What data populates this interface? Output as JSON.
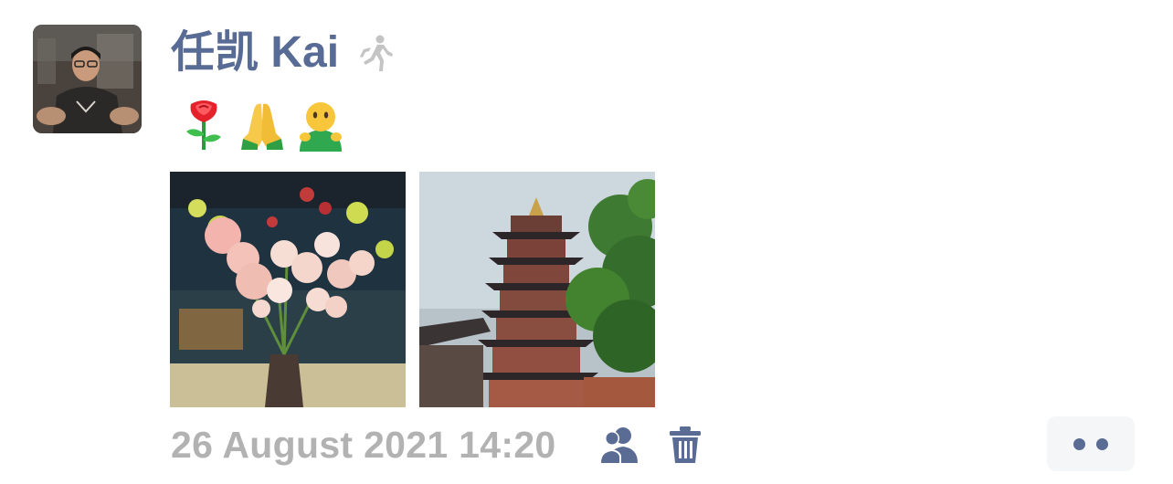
{
  "post": {
    "author": {
      "name": "任凯 Kai"
    },
    "content": {
      "emojis": [
        "🌹",
        "🙏",
        "🙂"
      ]
    },
    "timestamp": "26 August 2021 14:20"
  },
  "colors": {
    "name_link": "#586b95",
    "timestamp": "#b2b2b2",
    "icon_accent": "#5a6c94",
    "more_button_bg": "#f5f6f8"
  },
  "icons": {
    "status": "walking-person-icon",
    "visibility": "people-icon",
    "delete": "trash-icon",
    "more": "more-dots-icon"
  }
}
